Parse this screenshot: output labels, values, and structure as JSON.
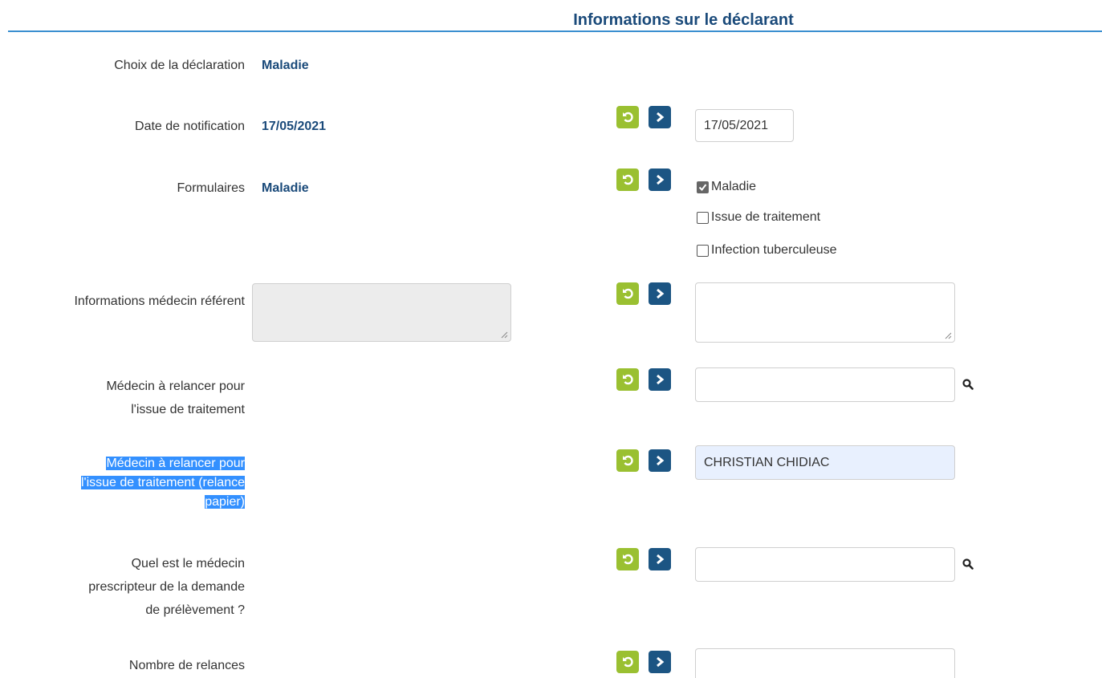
{
  "header": {
    "title": "Informations sur le déclarant"
  },
  "rows": {
    "choix": {
      "label": "Choix de la déclaration",
      "value": "Maladie"
    },
    "date": {
      "label": "Date de notification",
      "value": "17/05/2021",
      "input_value": "17/05/2021"
    },
    "formulaires": {
      "label": "Formulaires",
      "value": "Maladie",
      "options": [
        {
          "label": "Maladie",
          "checked": true
        },
        {
          "label": "Issue de traitement",
          "checked": false
        },
        {
          "label": "Infection tuberculeuse",
          "checked": false
        }
      ]
    },
    "medecin_referent": {
      "label": "Informations médecin référent"
    },
    "relance_issue": {
      "label_line1": "Médecin à relancer pour",
      "label_line2": "l'issue de traitement",
      "input_value": ""
    },
    "relance_papier": {
      "label_line1": "Médecin à relancer pour",
      "label_line2": "l'issue de traitement (relance",
      "label_line3": "papier)",
      "input_value": "CHRISTIAN CHIDIAC"
    },
    "prescripteur": {
      "label_line1": "Quel est le médecin",
      "label_line2": "prescripteur de la demande",
      "label_line3": "de prélèvement ?",
      "input_value": ""
    },
    "relances": {
      "label": "Nombre de relances",
      "input_value": ""
    }
  },
  "icons": {
    "undo": "undo-icon",
    "next": "chevron-right-icon",
    "search": "search-icon",
    "resize": "resize-grip-icon"
  },
  "colors": {
    "accent": "#1a4a7a",
    "undo_button": "#9ac031",
    "next_button": "#1c5583",
    "selection": "#3390ff",
    "autofill_bg": "#e8f0fe"
  }
}
